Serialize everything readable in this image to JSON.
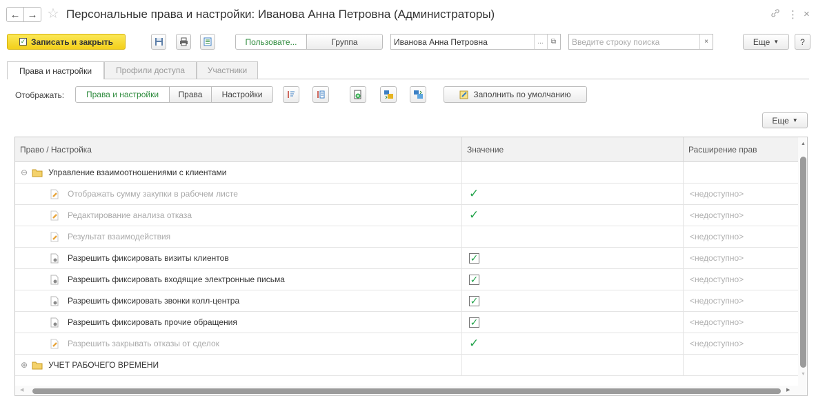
{
  "window": {
    "title": "Персональные права и настройки: Иванова Анна Петровна (Администраторы)"
  },
  "toolbar": {
    "save_close_label": "Записать и закрыть",
    "user_label": "Пользовате...",
    "group_label": "Группа",
    "user_value": "Иванова Анна Петровна",
    "search_placeholder": "Введите строку поиска",
    "more_label": "Еще",
    "help_label": "?"
  },
  "tabs": [
    {
      "label": "Права и настройки",
      "active": true
    },
    {
      "label": "Профили доступа",
      "active": false
    },
    {
      "label": "Участники",
      "active": false
    }
  ],
  "display": {
    "label": "Отображать:",
    "options": [
      "Права и настройки",
      "Права",
      "Настройки"
    ],
    "selected": "Права и настройки",
    "fill_default_label": "Заполнить по умолчанию",
    "more_label": "Еще"
  },
  "table": {
    "columns": [
      "Право / Настройка",
      "Значение",
      "Расширение прав"
    ],
    "rows": [
      {
        "type": "group",
        "expanded": true,
        "name": "Управление взаимоотношениями с клиентами",
        "value": "",
        "ext": ""
      },
      {
        "type": "setting",
        "enabled": false,
        "name": "Отображать сумму закупки в рабочем листе",
        "value": "check",
        "ext": "<недоступно>"
      },
      {
        "type": "setting",
        "enabled": false,
        "name": "Редактирование анализа отказа",
        "value": "check",
        "ext": "<недоступно>"
      },
      {
        "type": "setting",
        "enabled": false,
        "name": "Результат взаимодействия",
        "value": "",
        "ext": "<недоступно>"
      },
      {
        "type": "right",
        "enabled": true,
        "name": "Разрешить фиксировать визиты клиентов",
        "value": "checkbox",
        "ext": "<недоступно>"
      },
      {
        "type": "right",
        "enabled": true,
        "name": "Разрешить фиксировать входящие электронные письма",
        "value": "checkbox",
        "ext": "<недоступно>"
      },
      {
        "type": "right",
        "enabled": true,
        "name": "Разрешить фиксировать звонки колл-центра",
        "value": "checkbox",
        "ext": "<недоступно>"
      },
      {
        "type": "right",
        "enabled": true,
        "name": "Разрешить фиксировать прочие обращения",
        "value": "checkbox",
        "ext": "<недоступно>"
      },
      {
        "type": "setting",
        "enabled": false,
        "name": "Разрешить закрывать отказы от сделок",
        "value": "check",
        "ext": "<недоступно>"
      },
      {
        "type": "group",
        "expanded": false,
        "name": "УЧЕТ РАБОЧЕГО ВРЕМЕНИ",
        "value": "",
        "ext": ""
      }
    ]
  },
  "colors": {
    "accent_green": "#2e8b3d",
    "check_green": "#22a34a",
    "primary_yellow": "#f3cf1a"
  }
}
